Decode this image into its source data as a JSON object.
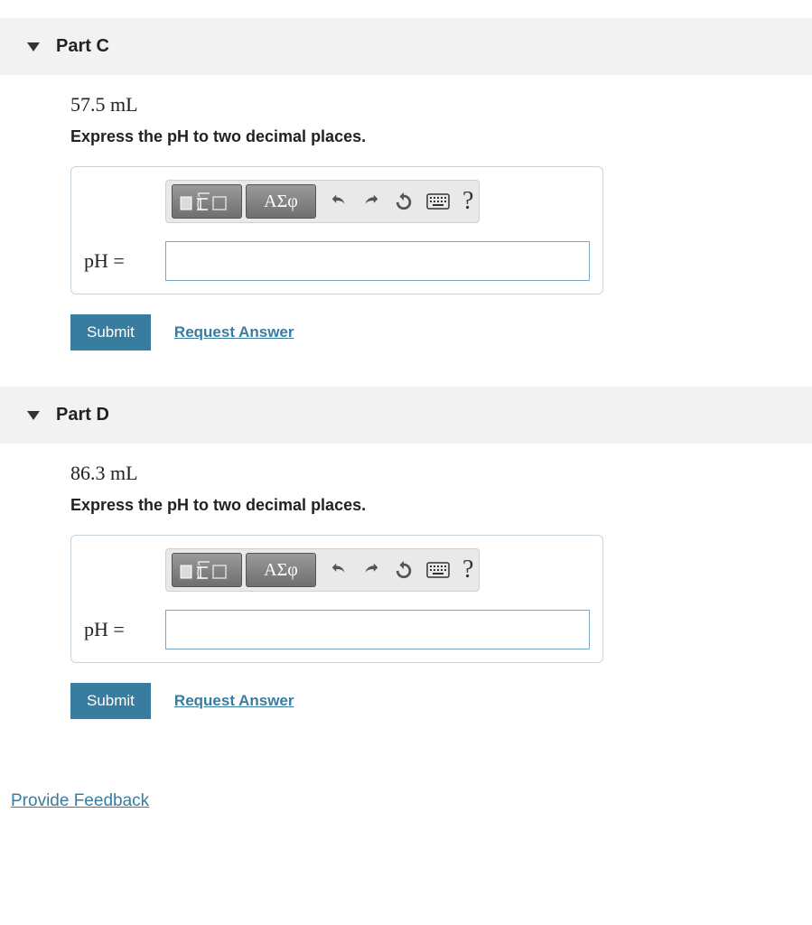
{
  "parts": [
    {
      "title": "Part C",
      "value": "57.5 mL",
      "instruction": "Express the pH to two decimal places.",
      "greek_label": "ΑΣφ",
      "help_label": "?",
      "input_label": "pH =",
      "input_value": "",
      "submit_label": "Submit",
      "request_label": "Request Answer"
    },
    {
      "title": "Part D",
      "value": "86.3 mL",
      "instruction": "Express the pH to two decimal places.",
      "greek_label": "ΑΣφ",
      "help_label": "?",
      "input_label": "pH =",
      "input_value": "",
      "submit_label": "Submit",
      "request_label": "Request Answer"
    }
  ],
  "feedback_label": "Provide Feedback"
}
